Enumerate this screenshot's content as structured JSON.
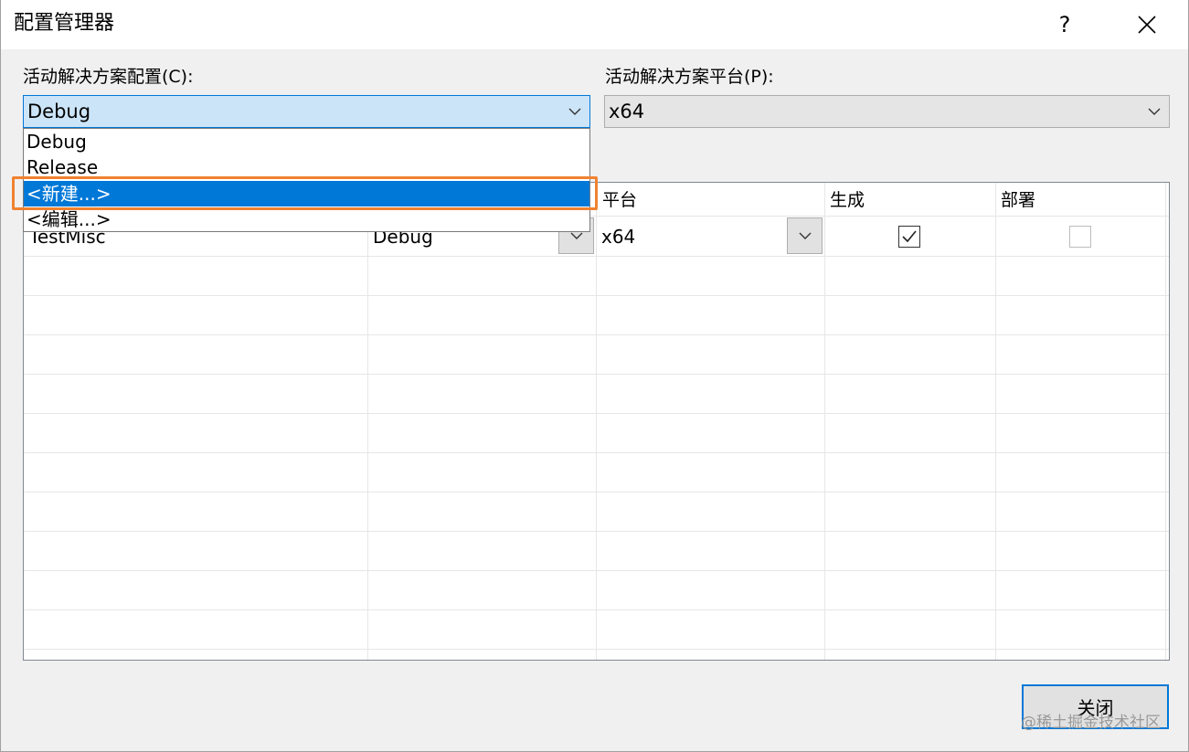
{
  "window": {
    "title": "配置管理器",
    "help_label": "?",
    "close_icon": "close-icon"
  },
  "config": {
    "label": "活动解决方案配置(C):",
    "selected": "Debug",
    "options": [
      "Debug",
      "Release",
      "<新建...>",
      "<编辑...>"
    ],
    "highlighted_option": "<新建...>"
  },
  "platform": {
    "label": "活动解决方案平台(P):",
    "selected": "x64"
  },
  "grid": {
    "headers": {
      "platform": "平台",
      "build": "生成",
      "deploy": "部署"
    },
    "rows": [
      {
        "project": "TestMisc",
        "configuration": "Debug",
        "platform": "x64",
        "build": true,
        "deploy": false
      }
    ]
  },
  "footer": {
    "close_label": "关闭",
    "watermark": "@稀土掘金技术社区"
  },
  "colors": {
    "accent": "#0078d7",
    "highlight_outline": "#f0822f",
    "combo_selected_bg": "#cce4f7"
  }
}
